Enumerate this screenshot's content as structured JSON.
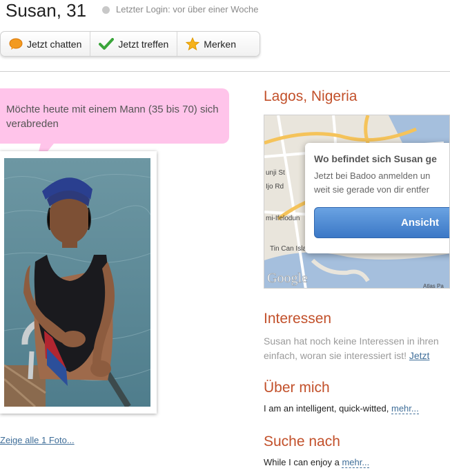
{
  "profile": {
    "name_age": "Susan, 31",
    "last_login": "Letzter Login: vor über einer Woche"
  },
  "actions": {
    "chat_label": "Jetzt chatten",
    "meet_label": "Jetzt treffen",
    "save_label": "Merken"
  },
  "bubble": {
    "text": "Möchte heute mit einem Mann (35 bis 70) sich verabreden"
  },
  "photos": {
    "show_all": "Zeige alle 1 Foto..."
  },
  "location": {
    "city": "Lagos, Nigeria",
    "map_labels": [
      "unji St",
      "Ijo Rd",
      "mi-Ifelodun",
      "Tin Can Island",
      "Google",
      "Atlas Pa"
    ],
    "overlay_title": "Wo befindet sich Susan ge",
    "overlay_line1": "Jetzt bei Badoo anmelden un",
    "overlay_line2": "weit sie gerade von dir entfer",
    "overlay_button": "Ansicht"
  },
  "interests": {
    "title": "Interessen",
    "line1": "Susan hat noch keine Interessen in ihren",
    "line2": "einfach, woran sie interessiert ist!",
    "link": "Jetzt"
  },
  "about": {
    "title": "Über mich",
    "text": "I am an intelligent, quick-witted,",
    "more": "mehr..."
  },
  "seeking": {
    "title": "Suche nach",
    "text": "While I can enjoy a",
    "more": "mehr..."
  },
  "colors": {
    "accent": "#c2502a",
    "link": "#3e6d98",
    "bubble": "#ffc4ea",
    "button_blue": "#3b78c6"
  }
}
